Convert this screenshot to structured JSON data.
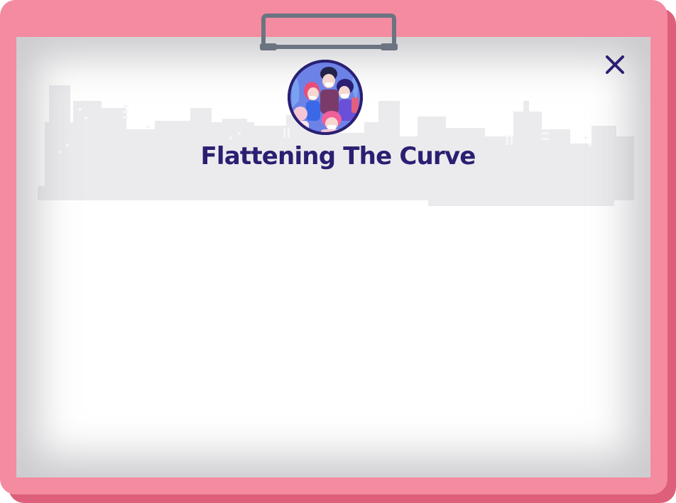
{
  "modal": {
    "title": "Flattening The Curve",
    "close_icon": "close-icon",
    "avatar_icon": "masked-crowd-illustration",
    "skyline_icon": "city-skyline-background"
  },
  "colors": {
    "frame": "#f48ba0",
    "frame_shadow": "#de5f79",
    "title": "#2a1f72",
    "close": "#2a1f72",
    "clip": "#6c7482",
    "avatar_border": "#2a1f72",
    "avatar_bg": "#5b6ee0",
    "skyline": "#e9e9ec"
  }
}
